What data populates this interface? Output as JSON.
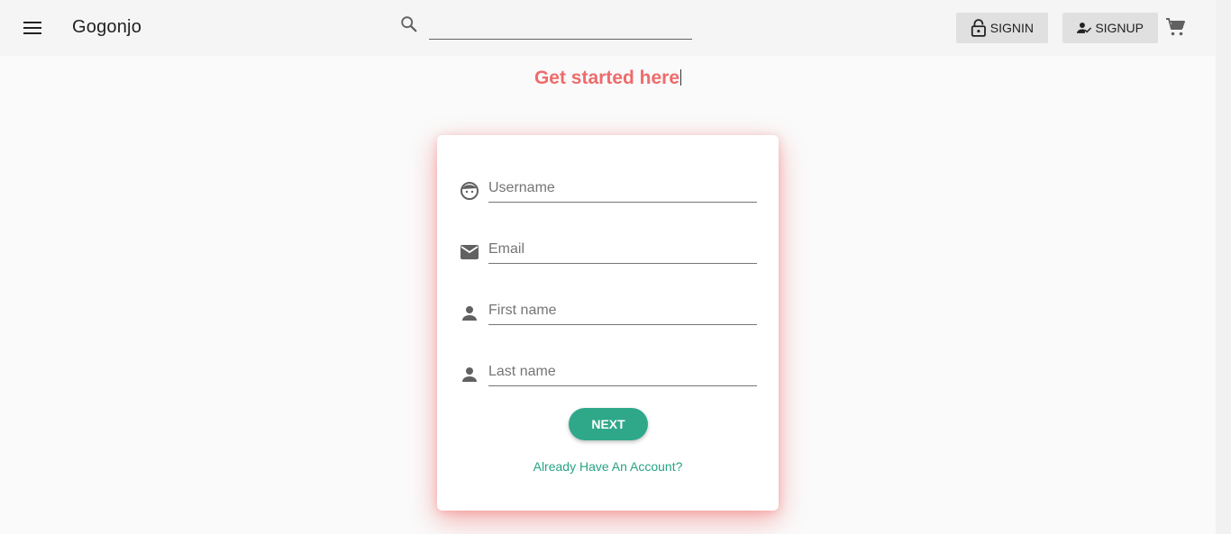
{
  "app": {
    "title": "Gogonjo"
  },
  "search": {
    "placeholder": "",
    "value": ""
  },
  "header": {
    "signin_label": "SIGNIN",
    "signup_label": "SIGNUP"
  },
  "main": {
    "heading": "Get started here"
  },
  "form": {
    "fields": [
      {
        "placeholder": "Username",
        "icon": "face-icon"
      },
      {
        "placeholder": "Email",
        "icon": "mail-icon"
      },
      {
        "placeholder": "First name",
        "icon": "person-icon"
      },
      {
        "placeholder": "Last name",
        "icon": "person-icon"
      }
    ],
    "next_label": "NEXT",
    "account_link": "Already Have An Account?"
  },
  "colors": {
    "accent": "#2fa88a",
    "heading": "#ef6b6b",
    "link": "#26a383"
  }
}
